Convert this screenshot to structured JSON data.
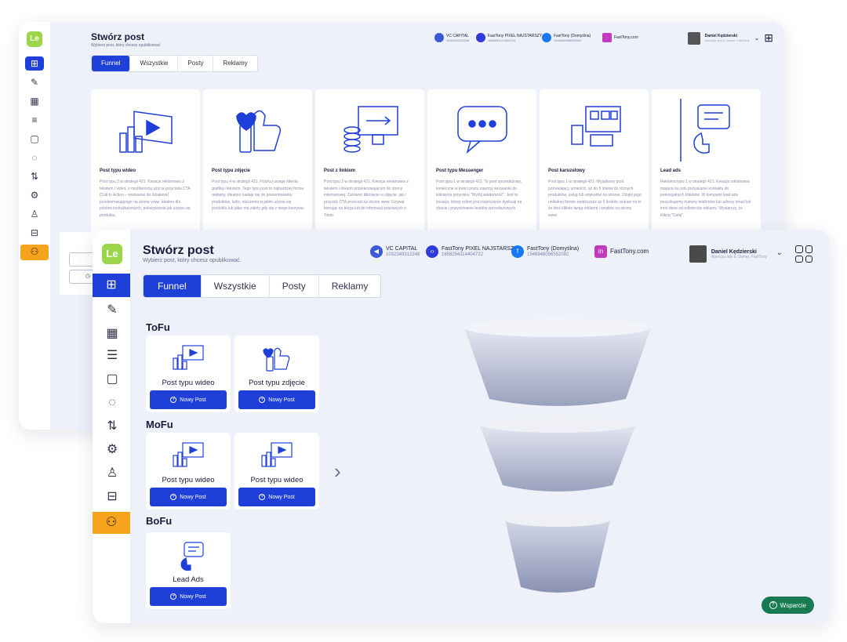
{
  "back": {
    "title": "Stwórz post",
    "subtitle": "Wybierz post, który chcesz opublikować.",
    "tabs": [
      "Funnel",
      "Wszystkie",
      "Posty",
      "Reklamy"
    ],
    "accounts": [
      {
        "name": "VC CAPITAL",
        "id": "1032349312248",
        "color": "#3b5bd8"
      },
      {
        "name": "FastTony PIXEL NAJSTARSZY",
        "id": "1658254114404722",
        "color": "#2f3bd8"
      },
      {
        "name": "FastTony (Domyślna)",
        "id": "1546948056552082",
        "color": "#1877f2"
      },
      {
        "name": "FastTony.com",
        "id": "",
        "color": "#c03bbe"
      }
    ],
    "user": {
      "name": "Daniel Kędzierski",
      "role": "Agencja ads & Owner, FastTony"
    },
    "cards": [
      {
        "title": "Post typu wideo",
        "desc": "Post typu 2 w strategii 421. Kreacja reklamowa z tekstem i video, z możliwością użycia przycisku CTA (Call to Action – wezwanie do działania) przekierowującego na stronę www. Idealna dla postów instruktażowych, pokazywania jak używa się produktu."
      },
      {
        "title": "Post typu zdjęcie",
        "desc": "Post typu 4 w strategii 421. Przykuj uwagę klienta grafiką i tekstem. Tego typu post to najbardziej forma reklamy, idealnie nadaje się do prezentowania produktów, ludzi, otoczenia w jakim używa się produktu lub jakie ma zalety gdy się z niego korzysta."
      },
      {
        "title": "Post z linkiem",
        "desc": "Post typu 2 w strategii 421. Kreacja reklamowa z tekstem i linkiem przekierowującym do strony internetowej. Zarówno kliknięcie w zdjęcie, jak i przycisk CTA przenosi na stronę www. Używaj kierując na bloga lub do informacji prasowych o Tobie."
      },
      {
        "title": "Post typu Messenger",
        "desc": "Post typu 1 w strategii 421. To post sprzedażowy, konieczne w treści postu zawrzyj wezwanie do kliknięcia przycisku \"Wyślij wiadomość\". Jest to kreacja, której celem jest rozpoczęcie dyskusji na chacie i pozyskiwanie leadów sprzedażowych."
      },
      {
        "title": "Post karuzelowy",
        "desc": "Post typu 1 w strategii 421. Wyjątkowy post pozwalający umieścić, aż do 5 linków do różnych produktów, usług lub artykułów na stronie. Dzięki jego unikalnej formie zwiększasz aż 5 krotnie szanse na to że ktoś kliknie twoją reklamę i wejdzie na stronę www."
      },
      {
        "title": "Lead ads",
        "desc": "Reklama typu 1 w strategii 421. Kreacja reklamowa mająca na celu pozyskanie kontaktu do potencjalnych klientów. W kampanii lead ads pozyskujemy numery telefonów lub adresy email lub inne dane od odbiorców reklamy. Wystarczy, że klikną \"Dalej\"."
      }
    ]
  },
  "front": {
    "logo": "Le",
    "title": "Stwórz post",
    "subtitle": "Wybierz post, który chcesz opublikować.",
    "tabs": [
      "Funnel",
      "Wszystkie",
      "Posty",
      "Reklamy"
    ],
    "accounts": [
      {
        "name": "VC CAPITAL",
        "id": "1032349312248",
        "color": "#3b5bd8",
        "icon": "megaphone-icon"
      },
      {
        "name": "FastTony PIXEL NAJSTARSZY",
        "id": "1658254114404722",
        "color": "#2f3bd8",
        "icon": "code-icon"
      },
      {
        "name": "FastTony (Domyślna)",
        "id": "1546948056552082",
        "color": "#1877f2",
        "icon": "facebook-icon"
      },
      {
        "name": "FastTony.com",
        "id": "",
        "color": "#c03bbe",
        "icon": "instagram-icon"
      }
    ],
    "user": {
      "name": "Daniel Kędzierski",
      "role": "Agencja ads & Owner, FastTony"
    },
    "stages": [
      {
        "label": "ToFu",
        "cards": [
          {
            "title": "Post typu wideo",
            "button": "Nowy Post"
          },
          {
            "title": "Post typu zdjęcie",
            "button": "Nowy Post"
          }
        ]
      },
      {
        "label": "MoFu",
        "cards": [
          {
            "title": "Post typu wideo",
            "button": "Nowy Post"
          },
          {
            "title": "Post typu wideo",
            "button": "Nowy Post"
          }
        ]
      },
      {
        "label": "BoFu",
        "cards": [
          {
            "title": "Lead Ads",
            "button": "Nowy Post"
          }
        ]
      }
    ],
    "support": "Wsparcie"
  },
  "colors": {
    "accent": "#1f3fd9",
    "orange": "#f6a31d",
    "logo_green": "#9bd64a",
    "support_green": "#177a52",
    "funnel": "#9aa1bd"
  }
}
